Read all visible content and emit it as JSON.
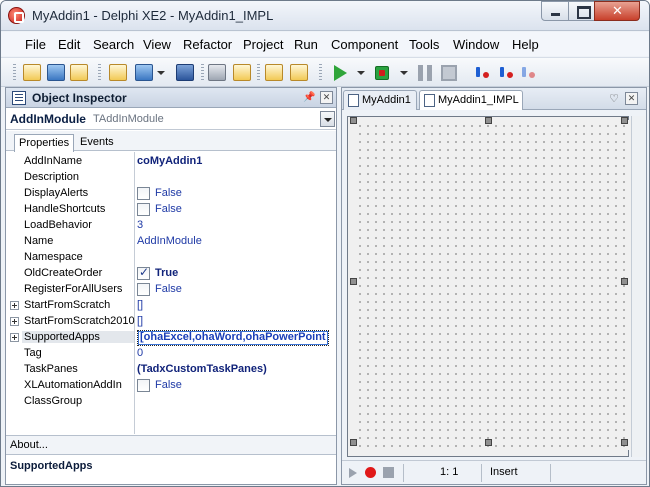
{
  "window": {
    "title": "MyAddin1 - Delphi XE2 - MyAddin1_IMPL"
  },
  "menu": {
    "items": [
      {
        "label": "File"
      },
      {
        "label": "Edit"
      },
      {
        "label": "Search"
      },
      {
        "label": "View"
      },
      {
        "label": "Refactor"
      },
      {
        "label": "Project"
      },
      {
        "label": "Run"
      },
      {
        "label": "Component"
      },
      {
        "label": "Tools"
      },
      {
        "label": "Window"
      },
      {
        "label": "Help"
      }
    ]
  },
  "object_inspector": {
    "title": "Object Inspector",
    "selected_component": {
      "name": "AddInModule",
      "type": "TAddInModule"
    },
    "tabs": {
      "properties": "Properties",
      "events": "Events"
    },
    "properties": [
      {
        "name": "AddInName",
        "value": "coMyAddin1"
      },
      {
        "name": "Description",
        "value": ""
      },
      {
        "name": "DisplayAlerts",
        "value": "False"
      },
      {
        "name": "HandleShortcuts",
        "value": "False"
      },
      {
        "name": "LoadBehavior",
        "value": "3"
      },
      {
        "name": "Name",
        "value": "AddInModule"
      },
      {
        "name": "Namespace",
        "value": ""
      },
      {
        "name": "OldCreateOrder",
        "value": "True"
      },
      {
        "name": "RegisterForAllUsers",
        "value": "False"
      },
      {
        "name": "StartFromScratch",
        "value": "[]"
      },
      {
        "name": "StartFromScratch2010",
        "value": "[]"
      },
      {
        "name": "SupportedApps",
        "value": "[ohaExcel,ohaWord,ohaPowerPoint"
      },
      {
        "name": "Tag",
        "value": "0"
      },
      {
        "name": "TaskPanes",
        "value": "(TadxCustomTaskPanes)"
      },
      {
        "name": "XLAutomationAddIn",
        "value": "False"
      },
      {
        "name": "ClassGroup",
        "value": ""
      }
    ],
    "about_label": "About...",
    "status_property": "SupportedApps"
  },
  "editor": {
    "tabs": [
      {
        "label": "MyAddin1"
      },
      {
        "label": "MyAddin1_IMPL"
      }
    ],
    "status": {
      "cursor_position": "1:   1",
      "mode": "Insert"
    }
  }
}
